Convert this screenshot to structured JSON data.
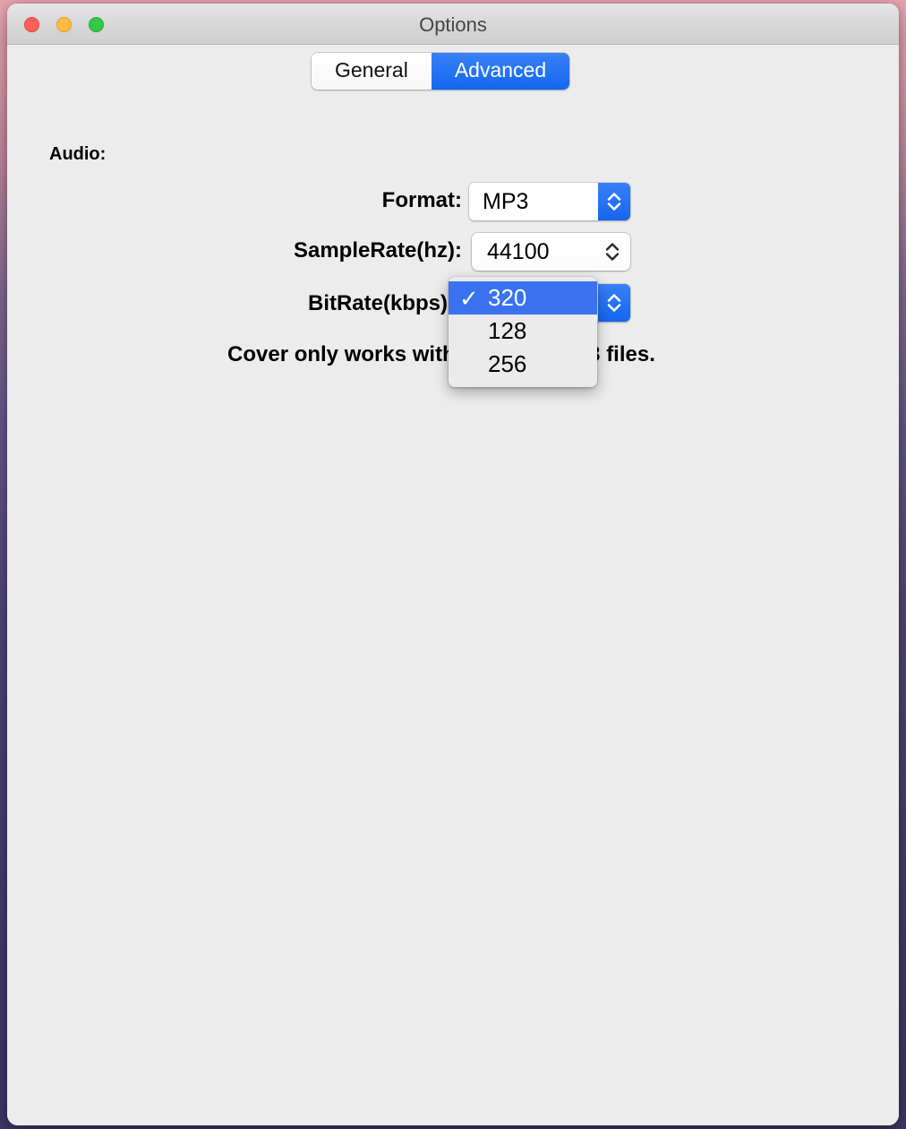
{
  "desktop": {
    "background_top": "#e9a8b4",
    "background_bottom": "#403a6b"
  },
  "window": {
    "title": "Options",
    "traffic_lights": {
      "close": "#fc6058",
      "minimize": "#fdbc40",
      "maximize": "#34c749"
    }
  },
  "tabs": [
    {
      "label": "General",
      "active": false
    },
    {
      "label": "Advanced",
      "active": true
    }
  ],
  "section": {
    "audio_label": "Audio:"
  },
  "fields": {
    "format": {
      "label": "Format:",
      "value": "MP3",
      "control": "popup-button",
      "stepper_color": "#1466ef"
    },
    "samplerate": {
      "label": "SampleRate(hz):",
      "value": "44100",
      "control": "combo-stepper"
    },
    "bitrate": {
      "label": "BitRate(kbps):",
      "value": "320",
      "control": "popup-button",
      "stepper_color": "#1466ef"
    }
  },
  "dropdown": {
    "open_for": "bitrate",
    "highlight_color": "#3b72f0",
    "items": [
      {
        "label": "320",
        "selected": true
      },
      {
        "label": "128",
        "selected": false
      },
      {
        "label": "256",
        "selected": false
      }
    ]
  },
  "note": {
    "text": "Cover only works with M4A and MP3 files."
  },
  "icons": {
    "stepper": "up-down-chevron-icon",
    "check": "✓"
  }
}
